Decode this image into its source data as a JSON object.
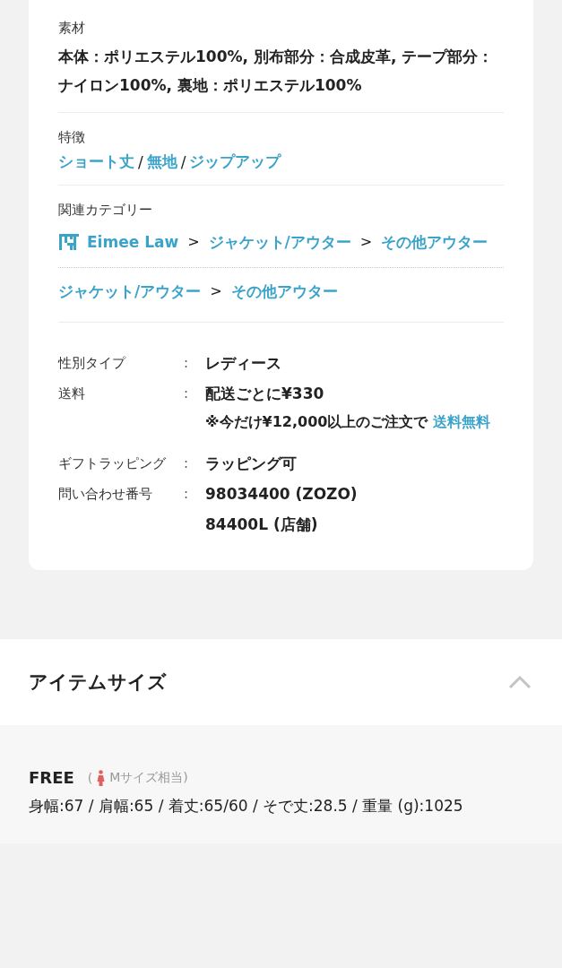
{
  "material": {
    "label": "素材",
    "text": "本体：ポリエステル100%, 別布部分：合成皮革, テープ部分：ナイロン100%, 裏地：ポリエステル100%"
  },
  "features": {
    "label": "特徴",
    "links": [
      "ショート丈",
      "無地",
      "ジップアップ"
    ],
    "separator": "/"
  },
  "categories": {
    "label": "関連カテゴリー",
    "paths": [
      {
        "shop": "Eimee Law",
        "links": [
          "ジャケット/アウター",
          "その他アウター"
        ]
      },
      {
        "links": [
          "ジャケット/アウター",
          "その他アウター"
        ]
      }
    ],
    "arrow": ">"
  },
  "specs": [
    {
      "label": "性別タイプ",
      "colon": ":",
      "values": [
        "レディース"
      ]
    },
    {
      "label": "送料",
      "colon": ":",
      "values": [
        "配送ごとに¥330"
      ],
      "note": "※今だけ¥12,000以上のご注文で",
      "note_link": "送料無料"
    },
    {
      "label": "ギフトラッピング",
      "colon": ":",
      "values": [
        "ラッピング可"
      ]
    },
    {
      "label": "問い合わせ番号",
      "colon": ":",
      "values": [
        "98034400 (ZOZO)",
        "84400L (店舗)"
      ]
    }
  ],
  "item_size": {
    "title": "アイテムサイズ",
    "expanded": true,
    "size": "FREE",
    "open_paren": "(",
    "equivalent": "Mサイズ相当)",
    "measurements": "身幅:67 / 肩幅:65 / 着丈:65/60 / そで丈:28.5 / 重量 (g):1025"
  }
}
